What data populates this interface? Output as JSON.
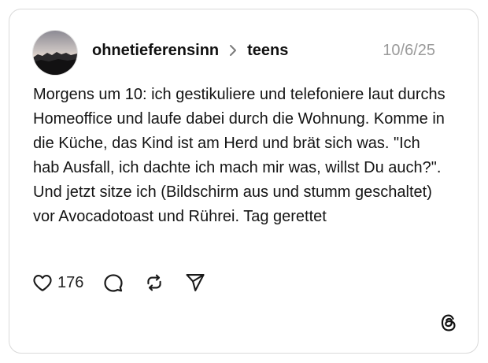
{
  "post": {
    "author": "ohnetieferensinn",
    "channel": "teens",
    "date": "10/6/25",
    "text": "Morgens um 10: ich gestikuliere und telefoniere laut durchs Homeoffice und laufe dabei durch die Wohnung. Komme in die Küche, das Kind ist am Herd und brät sich was. \"Ich hab Ausfall, ich dachte ich mach mir was, willst Du auch?\". Und jetzt sitze ich (Bildschirm aus und stumm geschaltet) vor Avocadotoast und Rührei. Tag gerettet",
    "likes": "176"
  },
  "icons": {
    "like": "heart-icon",
    "reply": "comment-bubble-icon",
    "repost": "repost-icon",
    "share": "send-icon",
    "chevron": "chevron-right-icon",
    "brand": "threads-logo-icon"
  },
  "colors": {
    "text": "#111111",
    "muted": "#9a9a9a",
    "border": "#d9d9d9",
    "background": "#ffffff"
  }
}
